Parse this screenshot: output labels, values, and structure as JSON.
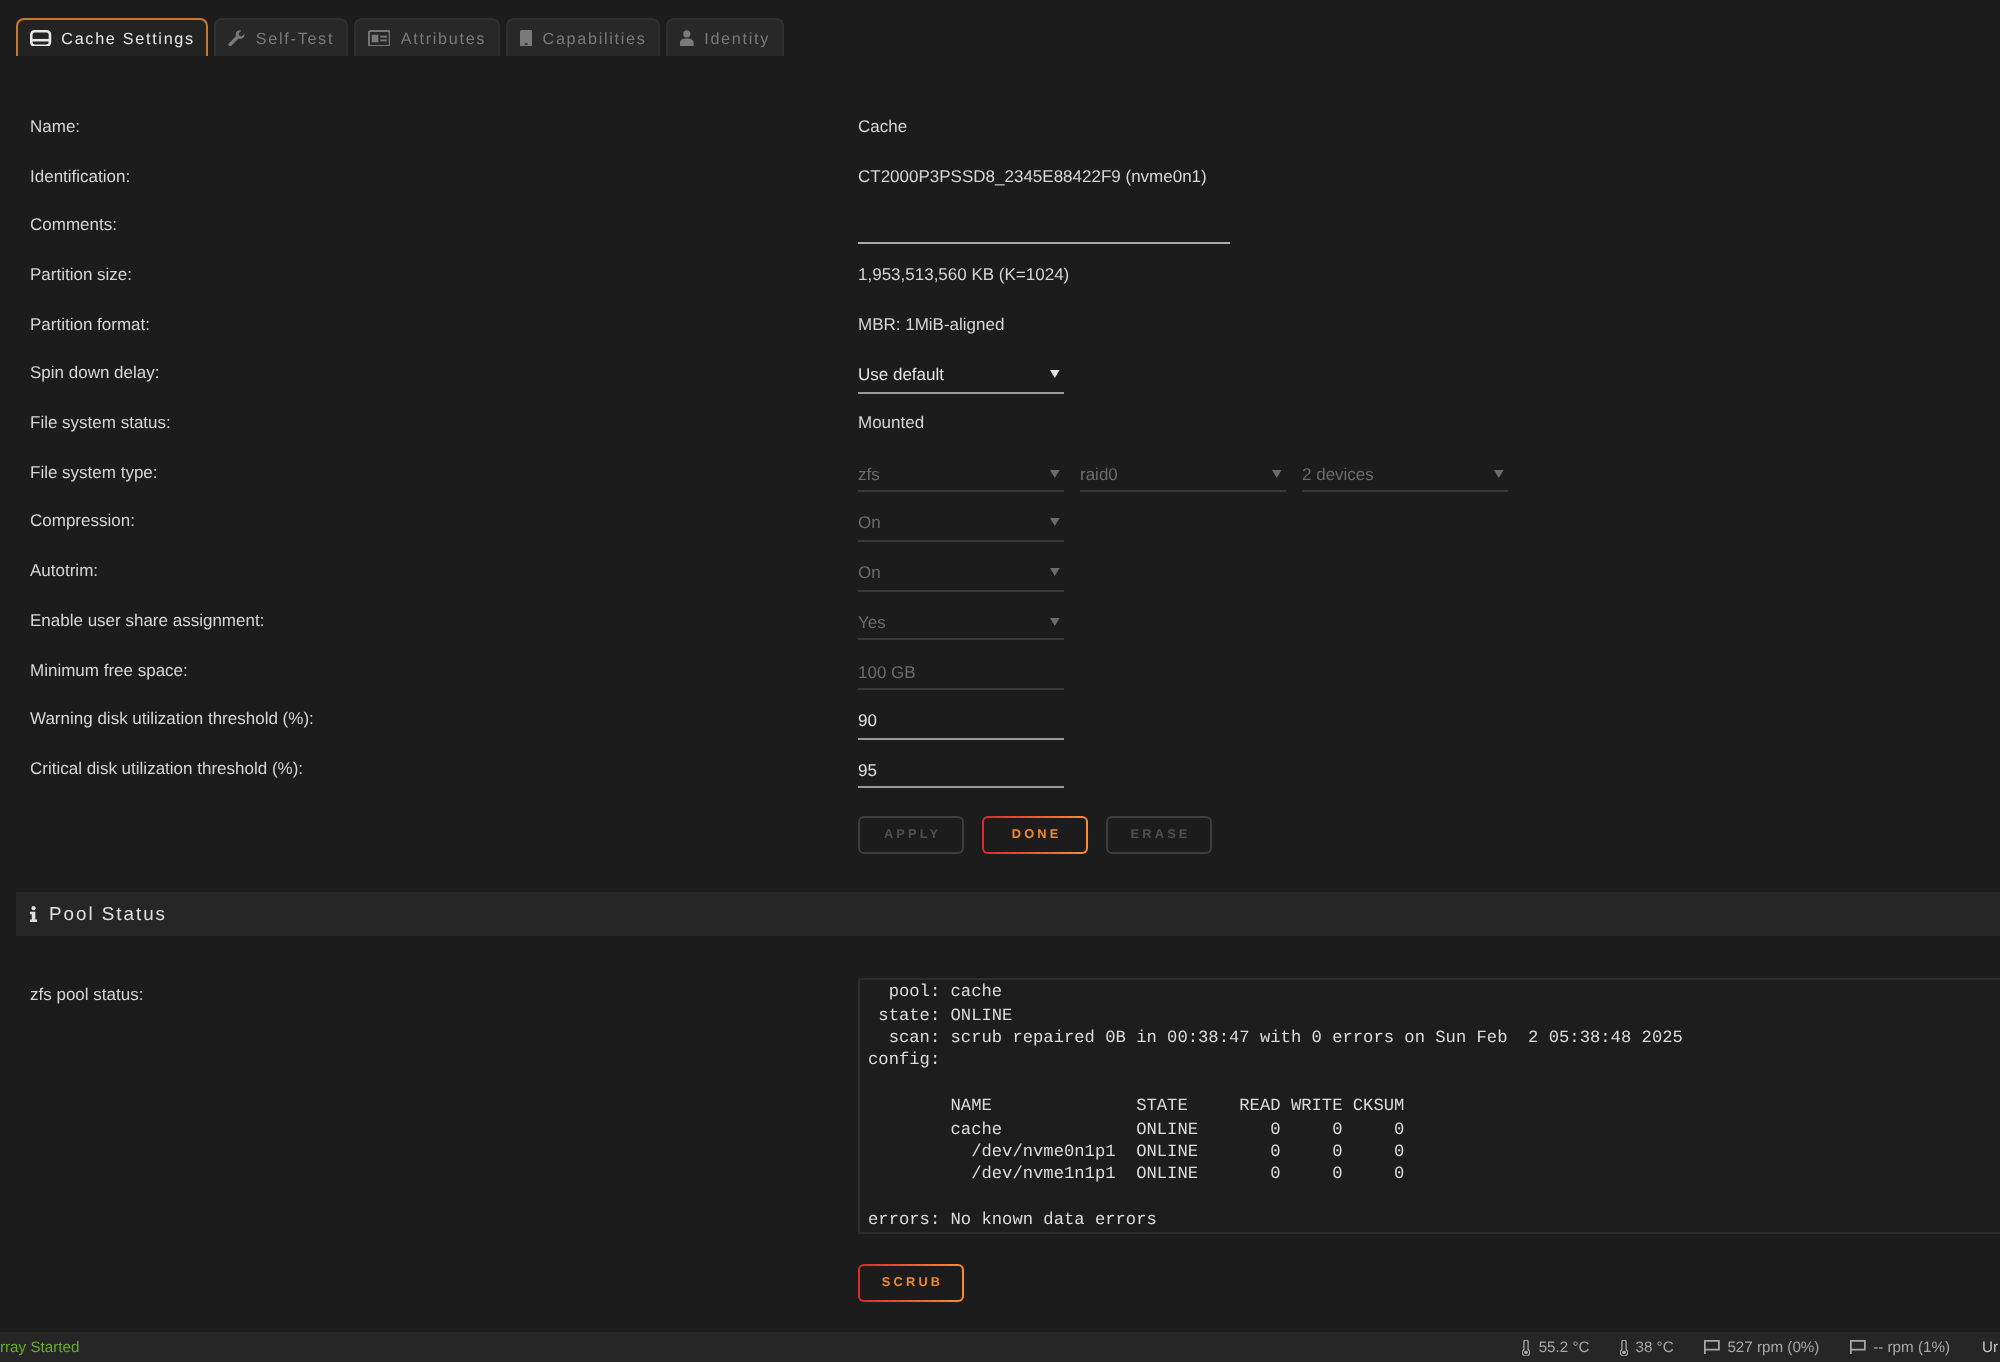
{
  "tabs": [
    {
      "label": "Cache Settings",
      "selected": true
    },
    {
      "label": "Self-Test",
      "selected": false
    },
    {
      "label": "Attributes",
      "selected": false
    },
    {
      "label": "Capabilities",
      "selected": false
    },
    {
      "label": "Identity",
      "selected": false
    }
  ],
  "settings": {
    "rows": [
      {
        "label": "Name:",
        "controls": [
          {
            "kind": "text",
            "value": "Cache"
          }
        ]
      },
      {
        "label": "Identification:",
        "controls": [
          {
            "kind": "text",
            "value": "CT2000P3PSSD8_2345E88422F9 (nvme0n1)"
          }
        ]
      },
      {
        "label": "Comments:",
        "controls": [
          {
            "kind": "comment",
            "disabled": false
          }
        ]
      },
      {
        "label": "Partition size:",
        "controls": [
          {
            "kind": "text",
            "value": "1,953,513,560 KB (K=1024)"
          }
        ]
      },
      {
        "label": "Partition format:",
        "controls": [
          {
            "kind": "text",
            "value": "MBR: 1MiB-aligned"
          }
        ]
      },
      {
        "label": "Spin down delay:",
        "controls": [
          {
            "kind": "select",
            "value": "Use default",
            "disabled": false
          }
        ]
      },
      {
        "label": "File system status:",
        "controls": [
          {
            "kind": "text",
            "value": "Mounted"
          }
        ]
      },
      {
        "label": "File system type:",
        "controls": [
          {
            "kind": "select",
            "value": "zfs",
            "disabled": true
          },
          {
            "kind": "select",
            "value": "raid0",
            "disabled": true
          },
          {
            "kind": "select",
            "value": "2 devices",
            "disabled": true
          }
        ]
      },
      {
        "label": "Compression:",
        "controls": [
          {
            "kind": "select",
            "value": "On",
            "disabled": true
          }
        ]
      },
      {
        "label": "Autotrim:",
        "controls": [
          {
            "kind": "select",
            "value": "On",
            "disabled": true
          }
        ]
      },
      {
        "label": "Enable user share assignment:",
        "controls": [
          {
            "kind": "select",
            "value": "Yes",
            "disabled": true
          }
        ]
      },
      {
        "label": "Minimum free space:",
        "controls": [
          {
            "kind": "input",
            "value": "100 GB",
            "disabled": true
          }
        ]
      },
      {
        "label": "Warning disk utilization threshold (%):",
        "controls": [
          {
            "kind": "input",
            "value": "90",
            "disabled": false
          }
        ]
      },
      {
        "label": "Critical disk utilization threshold (%):",
        "controls": [
          {
            "kind": "input",
            "value": "95",
            "disabled": false
          }
        ]
      }
    ],
    "buttons": [
      {
        "label": "APPLY",
        "disabled": true
      },
      {
        "label": "DONE",
        "disabled": false
      },
      {
        "label": "ERASE",
        "disabled": true
      }
    ]
  },
  "pool_status": {
    "title": "Pool Status",
    "label": "zfs pool status:",
    "output": "  pool: cache\n state: ONLINE\n  scan: scrub repaired 0B in 00:38:47 with 0 errors on Sun Feb  2 05:38:48 2025\nconfig:\n\n        NAME              STATE     READ WRITE CKSUM\n        cache             ONLINE       0     0     0\n          /dev/nvme0n1p1  ONLINE       0     0     0\n          /dev/nvme1n1p1  ONLINE       0     0     0\n\nerrors: No known data errors",
    "button": {
      "label": "SCRUB",
      "disabled": false
    }
  },
  "status_bar": {
    "array_status": "rray Started",
    "readings": [
      {
        "kind": "temperature",
        "text": "55.2 °C"
      },
      {
        "kind": "temperature",
        "text": "38 °C"
      },
      {
        "kind": "fan",
        "text": "527 rpm (0%)"
      },
      {
        "kind": "fan",
        "text": "-- rpm (1%)"
      }
    ],
    "edge_text": "Ur"
  }
}
